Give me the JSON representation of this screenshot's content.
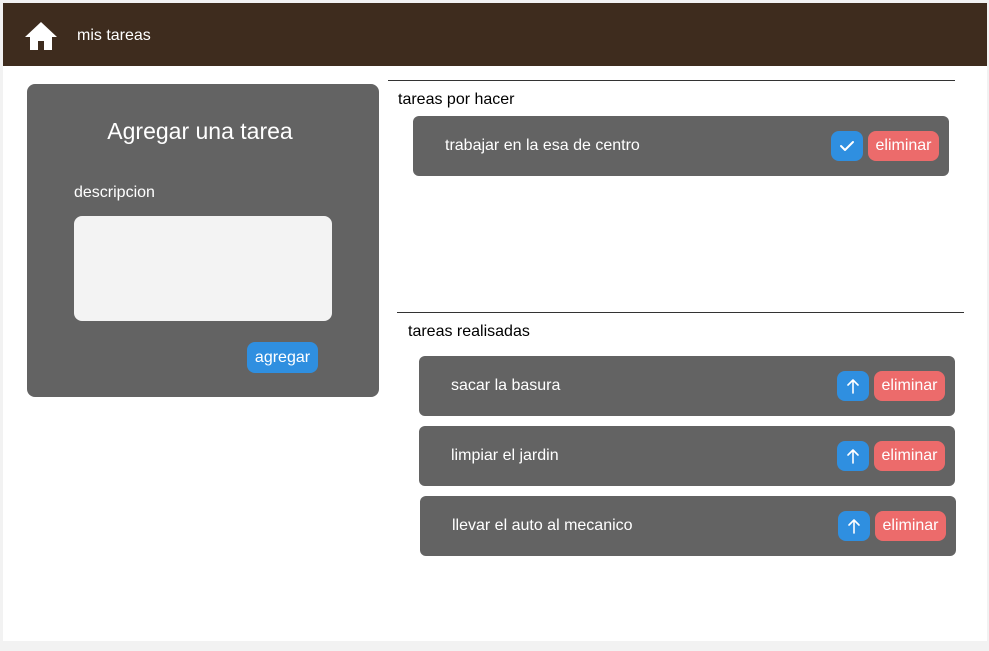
{
  "header": {
    "title": "mis tareas",
    "icon": "home-icon"
  },
  "add_form": {
    "title": "Agregar una tarea",
    "description_label": "descripcion",
    "description_value": "",
    "submit_label": "agregar"
  },
  "pending": {
    "label": "tareas  por hacer",
    "items": [
      {
        "text": "trabajar en la esa de centro",
        "action_icon": "check-icon",
        "delete_label": "eliminar"
      }
    ]
  },
  "done": {
    "label": "tareas  realisadas",
    "items": [
      {
        "text": "sacar la basura",
        "action_icon": "arrow-up-icon",
        "delete_label": "eliminar"
      },
      {
        "text": "limpiar el jardin",
        "action_icon": "arrow-up-icon",
        "delete_label": "eliminar"
      },
      {
        "text": "llevar el auto al mecanico",
        "action_icon": "arrow-up-icon",
        "delete_label": "eliminar"
      }
    ]
  },
  "colors": {
    "header_bg": "#3e2c1e",
    "panel_bg": "#636363",
    "primary": "#2f8fe0",
    "danger": "#ec6b6b"
  }
}
